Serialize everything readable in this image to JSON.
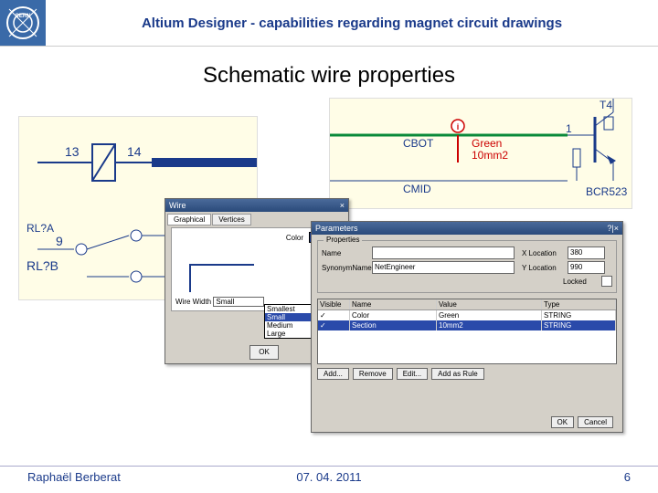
{
  "header": {
    "title": "Altium Designer - capabilities regarding magnet circuit drawings"
  },
  "subtitle": "Schematic wire properties",
  "schemLeft": {
    "refA": "RL?A",
    "refB": "RL?B",
    "pin13": "13",
    "pin14": "14",
    "pin9": "9"
  },
  "schemRight": {
    "cbot": "CBOT",
    "cmid": "CMID",
    "green": "Green",
    "sect": "10mm2",
    "t4": "T4",
    "one": "1",
    "bcr": "BCR523"
  },
  "wireDlg": {
    "title": "Wire",
    "closeX": "×",
    "tabGraphical": "Graphical",
    "tabVertices": "Vertices",
    "colorLabel": "Color",
    "wwLabel": "Wire Width",
    "wwValue": "Small",
    "opts": [
      "Smallest",
      "Small",
      "Medium",
      "Large"
    ],
    "ok": "OK"
  },
  "paramsDlg": {
    "title": "Parameters",
    "closeX": "?|×",
    "grpTitle": "Properties",
    "nameLabel": "Name",
    "nameVal": "",
    "xLabel": "X Location",
    "xVal": "380",
    "synLabel": "SynonymName",
    "synVal": "NetEngineer",
    "yLabel": "Y Location",
    "yVal": "990",
    "lockLabel": "Locked",
    "cols": [
      "Visible",
      "Name",
      "Value",
      "Type"
    ],
    "rows": [
      {
        "vis": "✓",
        "name": "Color",
        "val": "Green",
        "type": "STRING"
      },
      {
        "vis": "✓",
        "name": "Section",
        "val": "10mm2",
        "type": "STRING"
      }
    ],
    "btns": [
      "Add...",
      "Remove",
      "Edit...",
      "Add as Rule"
    ],
    "ok": "OK",
    "cancel": "Cancel"
  },
  "footer": {
    "author": "Raphaël Berberat",
    "date": "07. 04. 2011",
    "page": "6"
  }
}
